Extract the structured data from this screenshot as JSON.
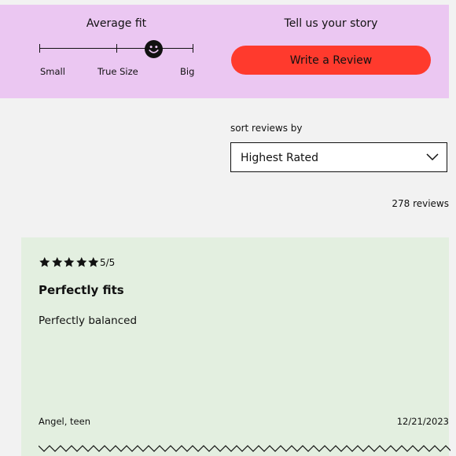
{
  "fit": {
    "title": "Average fit",
    "labels": [
      "Small",
      "True Size",
      "Big"
    ],
    "level": 0.74,
    "icon": "smiley-icon"
  },
  "story": {
    "title": "Tell us your story",
    "button_label": "Write a Review",
    "button_color": "#ff3a2d"
  },
  "colors": {
    "fit_panel": "#ebc7f2",
    "review_card": "#e3efe0",
    "page_bg": "#f2f2f2"
  },
  "sort": {
    "label": "sort reviews by",
    "selected": "Highest Rated",
    "icon": "chevron-down-icon"
  },
  "reviews_count": "278 reviews",
  "review": {
    "stars": 5,
    "rating": "5/5",
    "title": "Perfectly fits",
    "body": "Perfectly balanced",
    "author": "Angel, teen",
    "date": "12/21/2023"
  }
}
